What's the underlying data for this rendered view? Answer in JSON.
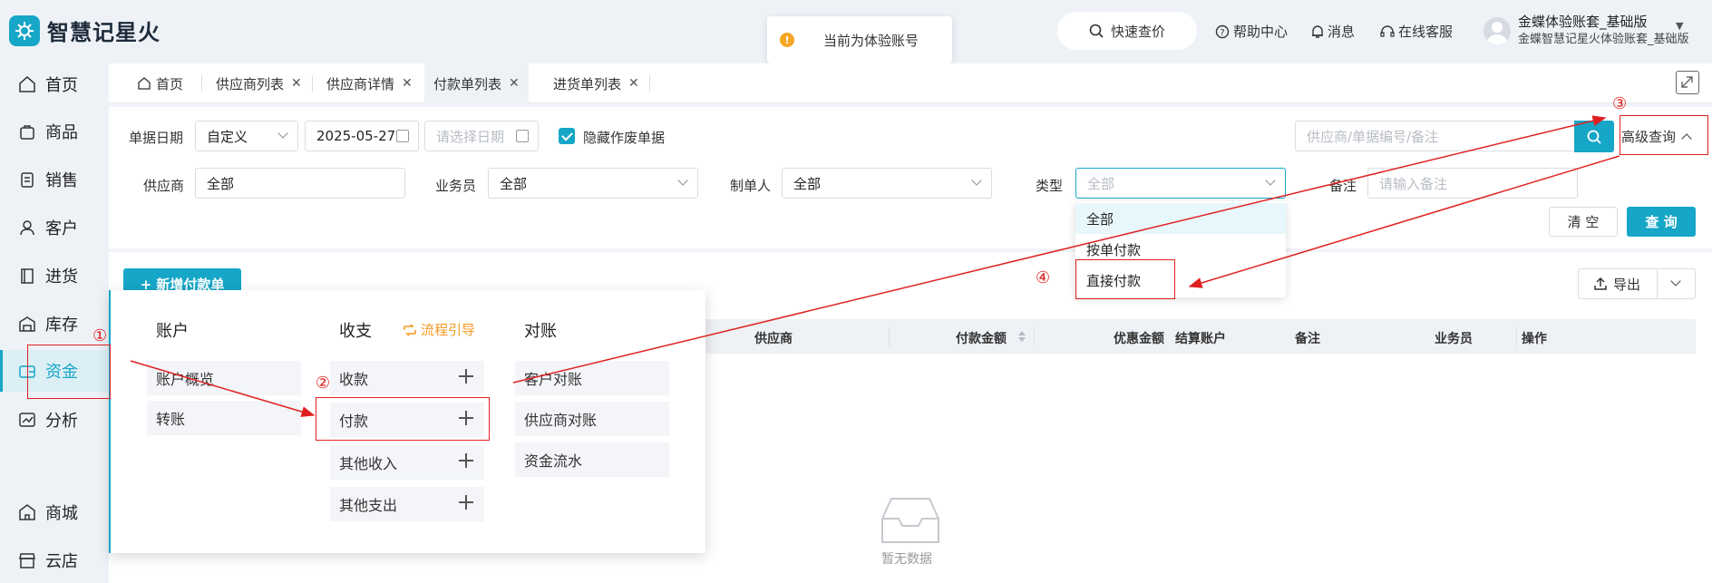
{
  "app": {
    "name": "智慧记星火"
  },
  "toast": {
    "text": "当前为体验账号"
  },
  "header": {
    "quick_price": "快速查价",
    "help": "帮助中心",
    "messages": "消息",
    "service": "在线客服",
    "user_name": "金蝶体验账套_基础版",
    "user_sub": "金蝶智慧记星火体验账套_基础版"
  },
  "sidebar": {
    "items": [
      {
        "label": "首页",
        "icon": "home-icon"
      },
      {
        "label": "商品",
        "icon": "bag-icon"
      },
      {
        "label": "销售",
        "icon": "clipboard-icon"
      },
      {
        "label": "客户",
        "icon": "person-icon"
      },
      {
        "label": "进货",
        "icon": "book-icon"
      },
      {
        "label": "库存",
        "icon": "warehouse-icon"
      },
      {
        "label": "资金",
        "icon": "wallet-icon",
        "active": true
      },
      {
        "label": "分析",
        "icon": "chart-icon"
      },
      {
        "label": "商城",
        "icon": "shop-icon"
      },
      {
        "label": "云店",
        "icon": "store-icon"
      }
    ]
  },
  "tabs": [
    {
      "label": "首页"
    },
    {
      "label": "供应商列表"
    },
    {
      "label": "供应商详情"
    },
    {
      "label": "付款单列表",
      "active": true
    },
    {
      "label": "进货单列表"
    }
  ],
  "filters": {
    "date_label": "单据日期",
    "date_mode": "自定义",
    "date_start": "2025-05-27",
    "date_end_placeholder": "请选择日期",
    "hide_void_label": "隐藏作废单据",
    "hide_void_checked": true,
    "search_placeholder": "供应商/单据编号/备注",
    "advanced_label": "高级查询",
    "supplier_label": "供应商",
    "supplier_value": "全部",
    "salesman_label": "业务员",
    "salesman_value": "全部",
    "maker_label": "制单人",
    "maker_value": "全部",
    "type_label": "类型",
    "type_value": "全部",
    "remark_label": "备注",
    "remark_placeholder": "请输入备注",
    "clear_label": "清 空",
    "query_label": "查 询"
  },
  "type_dropdown": {
    "options": [
      "全部",
      "按单付款",
      "直接付款"
    ],
    "selected": "全部"
  },
  "toolbar": {
    "new_label": "+ 新增付款单",
    "export_label": "导出"
  },
  "table": {
    "columns": [
      "供应商",
      "付款金额",
      "优惠金额",
      "结算账户",
      "备注",
      "业务员",
      "操作"
    ],
    "empty_text": "暂无数据"
  },
  "fund_menu": {
    "accounts": {
      "title": "账户",
      "items": [
        "账户概览",
        "转账"
      ]
    },
    "income_expense": {
      "title": "收支",
      "guide": "流程引导",
      "items": [
        "收款",
        "付款",
        "其他收入",
        "其他支出"
      ]
    },
    "reconcile": {
      "title": "对账",
      "items": [
        "客户对账",
        "供应商对账",
        "资金流水"
      ]
    }
  },
  "annotations": {
    "step1": "①",
    "step2": "②",
    "step3": "③",
    "step4": "④"
  },
  "colors": {
    "accent": "#16a6c7",
    "annotation": "#e02020",
    "guide": "#f59a23"
  }
}
